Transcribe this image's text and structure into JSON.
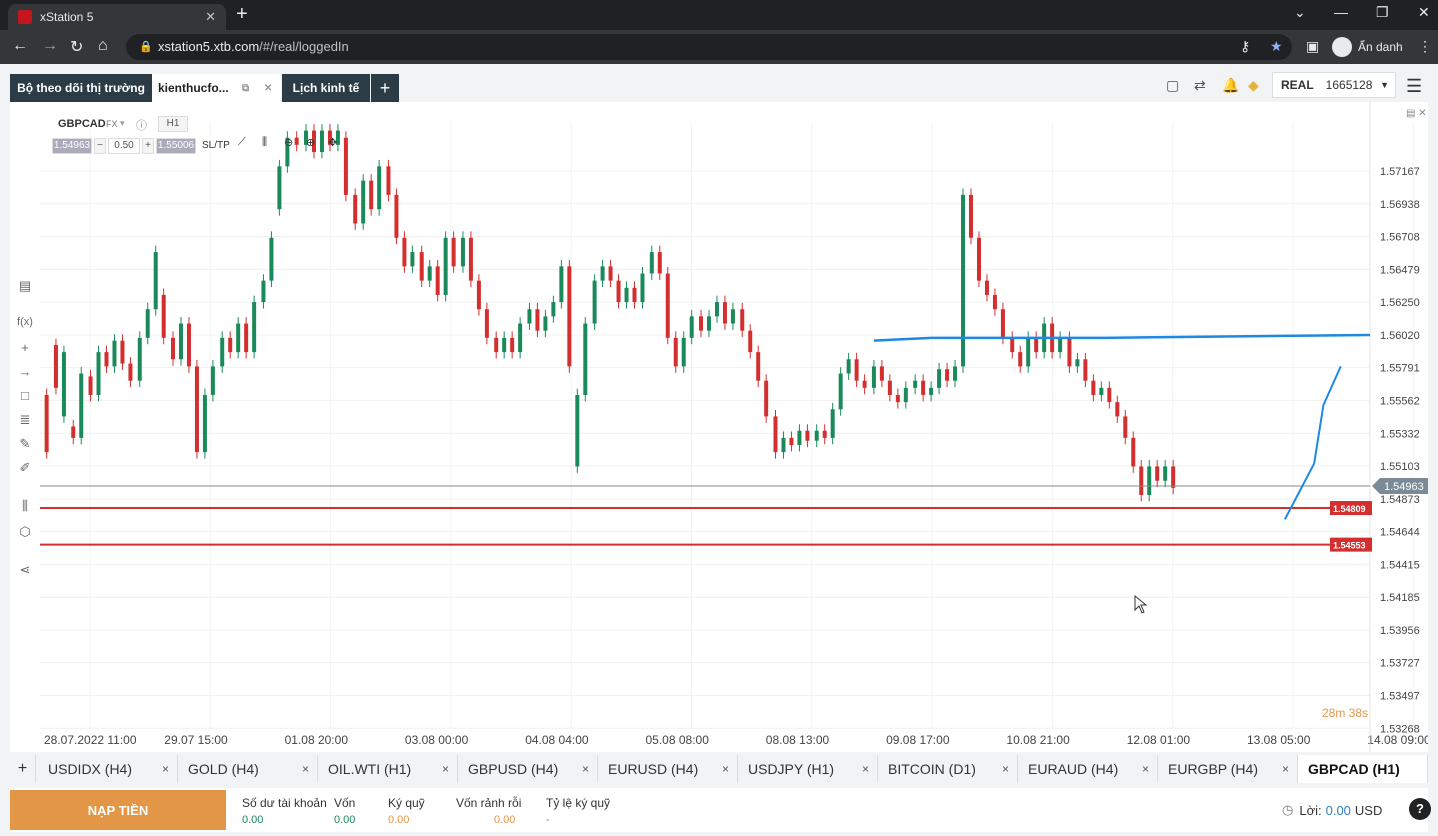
{
  "browser": {
    "tab_title": "xStation 5",
    "url_host": "xstation5.xtb.com",
    "url_path": "/#/real/loggedIn",
    "profile_name": "Ẩn danh"
  },
  "app_tabs": {
    "market_watch": "Bộ theo dõi thị trường",
    "workspace": "kienthucfo...",
    "calendar": "Lịch kinh tế",
    "add": "+"
  },
  "account": {
    "type": "REAL",
    "number": "1665128"
  },
  "chart": {
    "symbol": "GBPCAD",
    "market": "FX",
    "timeframe": "H1",
    "sell_price": "1.54963",
    "volume": "0.50",
    "buy_price": "1.55006",
    "sltp": "SL/TP",
    "countdown": "28m 38s"
  },
  "chart_data": {
    "type": "candlestick",
    "symbol": "GBPCAD",
    "timeframe": "H1",
    "y_ticks": [
      "1.57167",
      "1.56938",
      "1.56708",
      "1.56479",
      "1.56250",
      "1.56020",
      "1.55791",
      "1.55562",
      "1.55332",
      "1.55103",
      "1.54873",
      "1.54644",
      "1.54415",
      "1.54185",
      "1.53956",
      "1.53727",
      "1.53497",
      "1.53268"
    ],
    "x_ticks": [
      "28.07.2022 11:00",
      "29.07 15:00",
      "01.08 20:00",
      "03.08 00:00",
      "04.08 04:00",
      "05.08 08:00",
      "08.08 13:00",
      "09.08 17:00",
      "10.08 21:00",
      "12.08 01:00",
      "13.08 05:00",
      "14.08 09:00"
    ],
    "ylim": [
      1.5327,
      1.5751
    ],
    "current_price": 1.54963,
    "current_price_label": "1.54963",
    "hlines": [
      {
        "value": 1.54809,
        "label": "1.54809",
        "color": "#d32f2f"
      },
      {
        "value": 1.54553,
        "label": "1.54553",
        "color": "#d32f2f"
      }
    ],
    "trendline": {
      "color": "#1e88e5",
      "points": [
        [
          0.627,
          1.5598
        ],
        [
          0.67,
          1.56
        ],
        [
          0.8,
          1.56
        ],
        [
          1.0,
          1.5602
        ]
      ]
    },
    "projection": {
      "color": "#1e88e5",
      "points": [
        [
          0.936,
          1.5473
        ],
        [
          0.958,
          1.5512
        ],
        [
          0.965,
          1.5553
        ],
        [
          0.978,
          1.558
        ]
      ]
    },
    "candles": [
      [
        0.005,
        1.556,
        1.552
      ],
      [
        0.012,
        1.5595,
        1.5565
      ],
      [
        0.018,
        1.5545,
        1.559
      ],
      [
        0.025,
        1.5538,
        1.553
      ],
      [
        0.031,
        1.553,
        1.5575
      ],
      [
        0.038,
        1.5573,
        1.556
      ],
      [
        0.044,
        1.556,
        1.559
      ],
      [
        0.05,
        1.559,
        1.558
      ],
      [
        0.056,
        1.558,
        1.5598
      ],
      [
        0.062,
        1.5598,
        1.5582
      ],
      [
        0.068,
        1.5582,
        1.557
      ],
      [
        0.075,
        1.557,
        1.56
      ],
      [
        0.081,
        1.56,
        1.562
      ],
      [
        0.087,
        1.562,
        1.566
      ],
      [
        0.093,
        1.563,
        1.56
      ],
      [
        0.1,
        1.56,
        1.5585
      ],
      [
        0.106,
        1.5585,
        1.561
      ],
      [
        0.112,
        1.561,
        1.558
      ],
      [
        0.118,
        1.558,
        1.552
      ],
      [
        0.124,
        1.552,
        1.556
      ],
      [
        0.13,
        1.556,
        1.558
      ],
      [
        0.137,
        1.558,
        1.56
      ],
      [
        0.143,
        1.56,
        1.559
      ],
      [
        0.149,
        1.559,
        1.561
      ],
      [
        0.155,
        1.561,
        1.559
      ],
      [
        0.161,
        1.559,
        1.5625
      ],
      [
        0.168,
        1.5625,
        1.564
      ],
      [
        0.174,
        1.564,
        1.567
      ],
      [
        0.18,
        1.569,
        1.572
      ],
      [
        0.186,
        1.572,
        1.574
      ],
      [
        0.193,
        1.574,
        1.5735
      ],
      [
        0.2,
        1.5735,
        1.5745
      ],
      [
        0.206,
        1.5745,
        1.573
      ],
      [
        0.212,
        1.573,
        1.5745
      ],
      [
        0.218,
        1.5745,
        1.5735
      ],
      [
        0.224,
        1.5735,
        1.5745
      ],
      [
        0.23,
        1.574,
        1.57
      ],
      [
        0.237,
        1.57,
        1.568
      ],
      [
        0.243,
        1.568,
        1.571
      ],
      [
        0.249,
        1.571,
        1.569
      ],
      [
        0.255,
        1.569,
        1.572
      ],
      [
        0.262,
        1.572,
        1.57
      ],
      [
        0.268,
        1.57,
        1.567
      ],
      [
        0.274,
        1.567,
        1.565
      ],
      [
        0.28,
        1.565,
        1.566
      ],
      [
        0.287,
        1.566,
        1.564
      ],
      [
        0.293,
        1.564,
        1.565
      ],
      [
        0.299,
        1.565,
        1.563
      ],
      [
        0.305,
        1.563,
        1.567
      ],
      [
        0.311,
        1.567,
        1.565
      ],
      [
        0.318,
        1.565,
        1.567
      ],
      [
        0.324,
        1.567,
        1.564
      ],
      [
        0.33,
        1.564,
        1.562
      ],
      [
        0.336,
        1.562,
        1.56
      ],
      [
        0.343,
        1.56,
        1.559
      ],
      [
        0.349,
        1.559,
        1.56
      ],
      [
        0.355,
        1.56,
        1.559
      ],
      [
        0.361,
        1.559,
        1.561
      ],
      [
        0.368,
        1.561,
        1.562
      ],
      [
        0.374,
        1.562,
        1.5605
      ],
      [
        0.38,
        1.5605,
        1.5615
      ],
      [
        0.386,
        1.5615,
        1.5625
      ],
      [
        0.392,
        1.5625,
        1.565
      ],
      [
        0.398,
        1.565,
        1.558
      ],
      [
        0.404,
        1.551,
        1.556
      ],
      [
        0.41,
        1.556,
        1.561
      ],
      [
        0.417,
        1.561,
        1.564
      ],
      [
        0.423,
        1.564,
        1.565
      ],
      [
        0.429,
        1.565,
        1.564
      ],
      [
        0.435,
        1.564,
        1.5625
      ],
      [
        0.441,
        1.5625,
        1.5635
      ],
      [
        0.447,
        1.5635,
        1.5625
      ],
      [
        0.453,
        1.5625,
        1.5645
      ],
      [
        0.46,
        1.5645,
        1.566
      ],
      [
        0.466,
        1.566,
        1.5645
      ],
      [
        0.472,
        1.5645,
        1.56
      ],
      [
        0.478,
        1.56,
        1.558
      ],
      [
        0.484,
        1.558,
        1.56
      ],
      [
        0.49,
        1.56,
        1.5615
      ],
      [
        0.497,
        1.5615,
        1.5605
      ],
      [
        0.503,
        1.5605,
        1.5615
      ],
      [
        0.509,
        1.5615,
        1.5625
      ],
      [
        0.515,
        1.5625,
        1.561
      ],
      [
        0.521,
        1.561,
        1.562
      ],
      [
        0.528,
        1.562,
        1.5605
      ],
      [
        0.534,
        1.5605,
        1.559
      ],
      [
        0.54,
        1.559,
        1.557
      ],
      [
        0.546,
        1.557,
        1.5545
      ],
      [
        0.553,
        1.5545,
        1.552
      ],
      [
        0.559,
        1.552,
        1.553
      ],
      [
        0.565,
        1.553,
        1.5525
      ],
      [
        0.571,
        1.5525,
        1.5535
      ],
      [
        0.577,
        1.5535,
        1.5528
      ],
      [
        0.584,
        1.5528,
        1.5535
      ],
      [
        0.59,
        1.5535,
        1.553
      ],
      [
        0.596,
        1.553,
        1.555
      ],
      [
        0.602,
        1.555,
        1.5575
      ],
      [
        0.608,
        1.5575,
        1.5585
      ],
      [
        0.614,
        1.5585,
        1.557
      ],
      [
        0.62,
        1.557,
        1.5565
      ],
      [
        0.627,
        1.5565,
        1.558
      ],
      [
        0.633,
        1.558,
        1.557
      ],
      [
        0.639,
        1.557,
        1.556
      ],
      [
        0.645,
        1.556,
        1.5555
      ],
      [
        0.651,
        1.5555,
        1.5565
      ],
      [
        0.658,
        1.5565,
        1.557
      ],
      [
        0.664,
        1.557,
        1.556
      ],
      [
        0.67,
        1.556,
        1.5565
      ],
      [
        0.676,
        1.5565,
        1.5578
      ],
      [
        0.682,
        1.5578,
        1.557
      ],
      [
        0.688,
        1.557,
        1.558
      ],
      [
        0.694,
        1.558,
        1.57
      ],
      [
        0.7,
        1.57,
        1.567
      ],
      [
        0.706,
        1.567,
        1.564
      ],
      [
        0.712,
        1.564,
        1.563
      ],
      [
        0.718,
        1.563,
        1.562
      ],
      [
        0.724,
        1.562,
        1.56
      ],
      [
        0.731,
        1.56,
        1.559
      ],
      [
        0.737,
        1.559,
        1.558
      ],
      [
        0.743,
        1.558,
        1.56
      ],
      [
        0.749,
        1.56,
        1.559
      ],
      [
        0.755,
        1.559,
        1.561
      ],
      [
        0.761,
        1.561,
        1.559
      ],
      [
        0.767,
        1.559,
        1.56
      ],
      [
        0.774,
        1.56,
        1.558
      ],
      [
        0.78,
        1.558,
        1.5585
      ],
      [
        0.786,
        1.5585,
        1.557
      ],
      [
        0.792,
        1.557,
        1.556
      ],
      [
        0.798,
        1.556,
        1.5565
      ],
      [
        0.804,
        1.5565,
        1.5555
      ],
      [
        0.81,
        1.5555,
        1.5545
      ],
      [
        0.816,
        1.5545,
        1.553
      ],
      [
        0.822,
        1.553,
        1.551
      ],
      [
        0.828,
        1.551,
        1.549
      ],
      [
        0.834,
        1.549,
        1.551
      ],
      [
        0.84,
        1.551,
        1.55
      ],
      [
        0.846,
        1.55,
        1.551
      ],
      [
        0.852,
        1.551,
        1.5495
      ]
    ]
  },
  "left_tools": [
    "panel-icon",
    "function-icon",
    "crosshair-icon",
    "line-icon",
    "rectangle-icon",
    "fibonacci-icon",
    "brush-icon",
    "pen-icon",
    "bars-icon",
    "layers-icon",
    "share-icon"
  ],
  "bottom_tabs": [
    {
      "label": "USDIDX (H4)",
      "close": "×"
    },
    {
      "label": "GOLD (H4)",
      "close": "×"
    },
    {
      "label": "OIL.WTI (H1)",
      "close": "×"
    },
    {
      "label": "GBPUSD (H4)",
      "close": "×"
    },
    {
      "label": "EURUSD (H4)",
      "close": "×"
    },
    {
      "label": "USDJPY (H1)",
      "close": "×"
    },
    {
      "label": "BITCOIN (D1)",
      "close": "×"
    },
    {
      "label": "EURAUD (H4)",
      "close": "×"
    },
    {
      "label": "EURGBP (H4)",
      "close": "×"
    },
    {
      "label": "GBPCAD (H1)",
      "close": ""
    }
  ],
  "footer": {
    "deposit": "NẠP TIỀN",
    "balance_label": "Số dư tài khoản",
    "balance": "0.00",
    "equity_label": "Vốn",
    "equity": "0.00",
    "margin_label": "Ký quỹ",
    "margin": "0.00",
    "free_margin_label": "Vốn rảnh rỗi",
    "free_margin": "0.00",
    "margin_level_label": "Tỷ lệ ký quỹ",
    "margin_level": "-",
    "profit_label": "Lời:",
    "profit": "0.00",
    "currency": "USD"
  },
  "colors": {
    "bull": "#1a8a5a",
    "bear": "#d32f2f",
    "accent": "#e39646",
    "nav": "#2c3c46"
  }
}
